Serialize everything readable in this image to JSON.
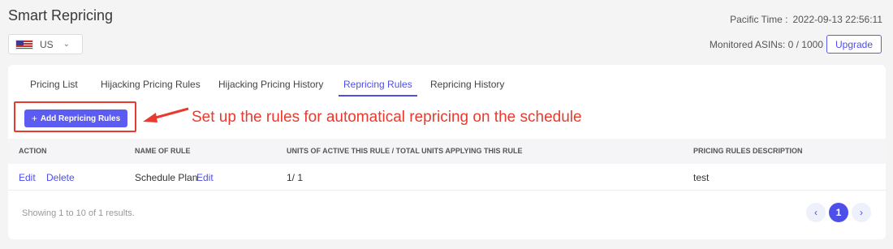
{
  "header": {
    "title": "Smart Repricing",
    "country": "US",
    "pacific_label": "Pacific Time :",
    "pacific_time": "2022-09-13 22:56:11",
    "monitored": "Monitored ASINs: 0 / 1000",
    "upgrade_label": "Upgrade"
  },
  "tabs": [
    {
      "label": "Pricing List"
    },
    {
      "label": "Hijacking Pricing Rules"
    },
    {
      "label": "Hijacking Pricing History"
    },
    {
      "label": "Repricing Rules"
    },
    {
      "label": "Repricing History"
    }
  ],
  "active_tab": "Repricing Rules",
  "toolbar": {
    "add_label": "Add Repricing Rules",
    "callout": "Set up the rules for automatical repricing on the schedule"
  },
  "table": {
    "columns": [
      "ACTION",
      "NAME OF RULE",
      "UNITS OF ACTIVE THIS RULE / TOTAL UNITS APPLYING THIS RULE",
      "PRICING RULES DESCRIPTION"
    ],
    "rows": [
      {
        "edit": "Edit",
        "delete": "Delete",
        "name": "Schedule Plan",
        "name_edit": "Edit",
        "units": "1/ 1",
        "description": "test"
      }
    ]
  },
  "footer": {
    "showing": "Showing 1 to 10 of 1 results.",
    "prev": "‹",
    "current_page": "1",
    "next": "›"
  },
  "colors": {
    "accent": "#4e4ee8",
    "button": "#5c5cf2",
    "annotation": "#e83a2e"
  }
}
